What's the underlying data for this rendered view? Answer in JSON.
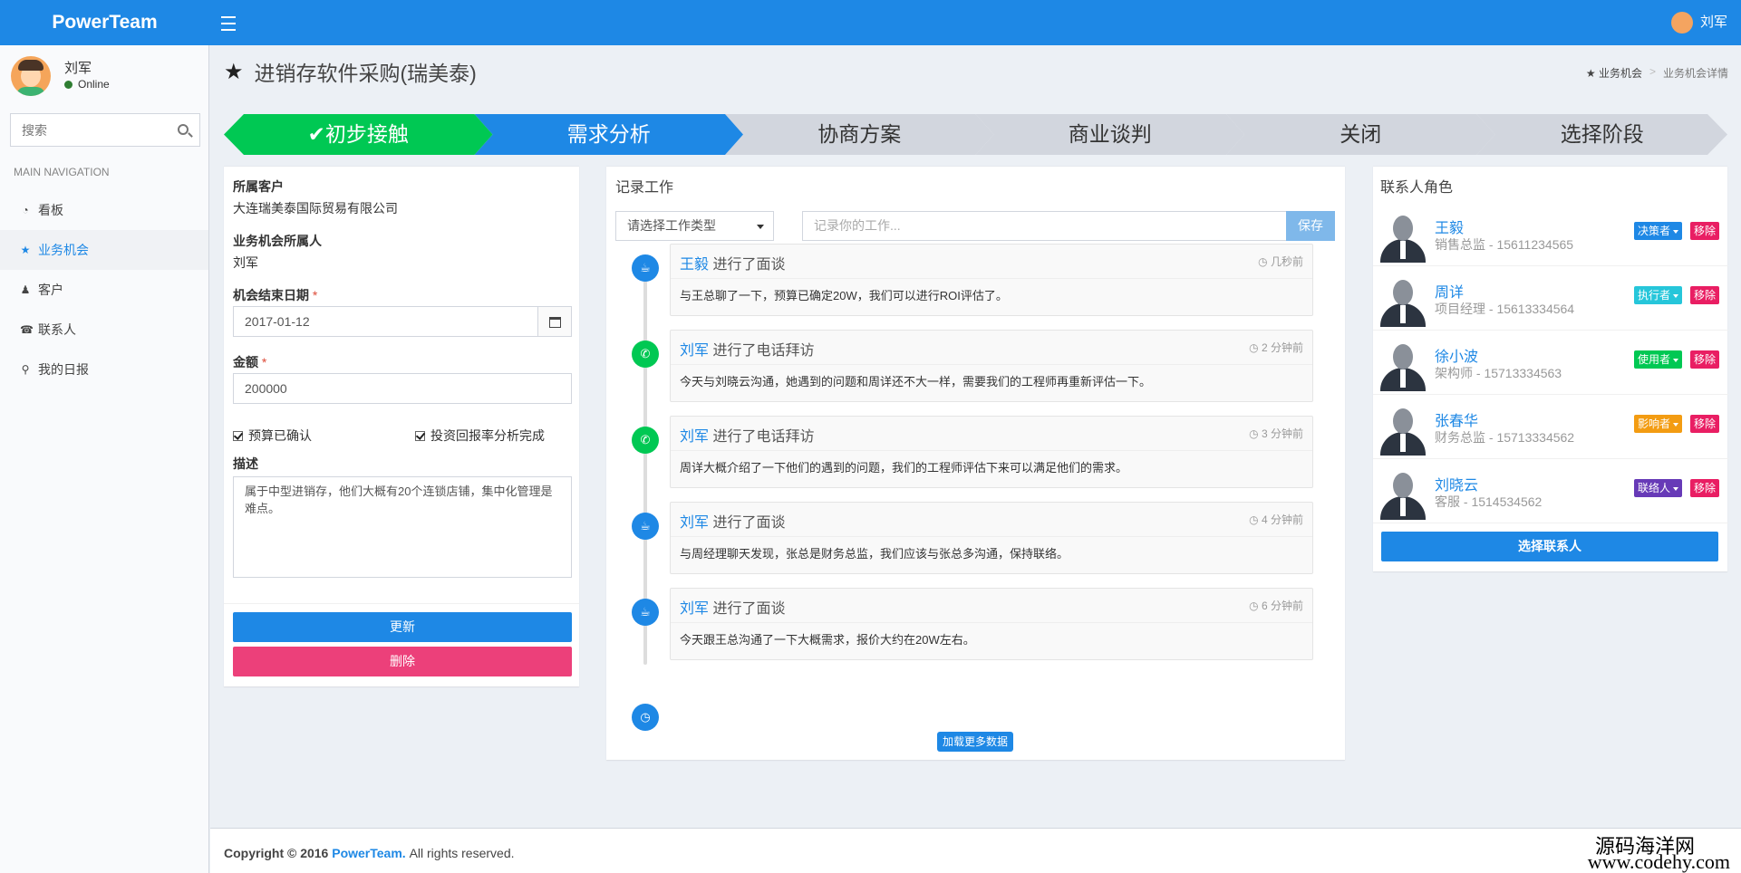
{
  "header": {
    "brand": "PowerTeam",
    "user_name": "刘军"
  },
  "sidebar": {
    "user": {
      "name": "刘军",
      "status": "Online"
    },
    "search_placeholder": "搜索",
    "nav_header": "MAIN NAVIGATION",
    "items": [
      {
        "label": "看板",
        "icon": "dashboard-icon",
        "active": false
      },
      {
        "label": "业务机会",
        "icon": "star-icon",
        "active": true
      },
      {
        "label": "客户",
        "icon": "user-icon",
        "active": false
      },
      {
        "label": "联系人",
        "icon": "phone-icon",
        "active": false
      },
      {
        "label": "我的日报",
        "icon": "pin-icon",
        "active": false
      }
    ]
  },
  "page": {
    "title": "进销存软件采购(瑞美泰)",
    "breadcrumb": [
      "业务机会",
      "业务机会详情"
    ]
  },
  "stages": [
    {
      "label": "✔初步接触",
      "state": "done",
      "color": "#00c853"
    },
    {
      "label": "需求分析",
      "state": "current",
      "color": "#1e88e5"
    },
    {
      "label": "协商方案",
      "state": "todo",
      "color": "#d2d6de"
    },
    {
      "label": "商业谈判",
      "state": "todo",
      "color": "#d2d6de"
    },
    {
      "label": "关闭",
      "state": "todo",
      "color": "#d2d6de"
    },
    {
      "label": "选择阶段",
      "state": "todo",
      "color": "#d2d6de"
    }
  ],
  "opportunity": {
    "customer_label": "所属客户",
    "customer_value": "大连瑞美泰国际贸易有限公司",
    "owner_label": "业务机会所属人",
    "owner_value": "刘军",
    "end_date_label": "机会结束日期",
    "end_date_value": "2017-01-12",
    "amount_label": "金额",
    "amount_value": "200000",
    "required_mark": "*",
    "check_budget": "预算已确认",
    "check_roi": "投资回报率分析完成",
    "desc_label": "描述",
    "desc_value": "属于中型进销存，他们大概有20个连锁店铺，集中化管理是难点。",
    "update_label": "更新",
    "delete_label": "删除"
  },
  "work_log": {
    "title": "记录工作",
    "type_placeholder": "请选择工作类型",
    "work_placeholder": "记录你的工作...",
    "save_label": "保存",
    "load_more": "加载更多数据",
    "entries": [
      {
        "user": "王毅",
        "action": "进行了面谈",
        "time": "几秒前",
        "body": "与王总聊了一下，预算已确定20W，我们可以进行ROI评估了。",
        "icon": "coffee-icon",
        "color": "#1e88e5"
      },
      {
        "user": "刘军",
        "action": "进行了电话拜访",
        "time": "2 分钟前",
        "body": "今天与刘晓云沟通，她遇到的问题和周详还不大一样，需要我们的工程师再重新评估一下。",
        "icon": "phone-icon",
        "color": "#00c853"
      },
      {
        "user": "刘军",
        "action": "进行了电话拜访",
        "time": "3 分钟前",
        "body": "周详大概介绍了一下他们的遇到的问题，我们的工程师评估下来可以满足他们的需求。",
        "icon": "phone-icon",
        "color": "#00c853"
      },
      {
        "user": "刘军",
        "action": "进行了面谈",
        "time": "4 分钟前",
        "body": "与周经理聊天发现，张总是财务总监，我们应该与张总多沟通，保持联络。",
        "icon": "coffee-icon",
        "color": "#1e88e5"
      },
      {
        "user": "刘军",
        "action": "进行了面谈",
        "time": "6 分钟前",
        "body": "今天跟王总沟通了一下大概需求，报价大约在20W左右。",
        "icon": "coffee-icon",
        "color": "#1e88e5"
      }
    ]
  },
  "contacts": {
    "title": "联系人角色",
    "remove_label": "移除",
    "choose_label": "选择联系人",
    "items": [
      {
        "name": "王毅",
        "info": "销售总监 - 15611234565",
        "role": "决策者",
        "role_color": "#1e88e5"
      },
      {
        "name": "周详",
        "info": "项目经理 - 15613334564",
        "role": "执行者",
        "role_color": "#26c6da"
      },
      {
        "name": "徐小波",
        "info": "架构师 - 15713334563",
        "role": "使用者",
        "role_color": "#00c853"
      },
      {
        "name": "张春华",
        "info": "财务总监 - 15713334562",
        "role": "影响者",
        "role_color": "#f39c12"
      },
      {
        "name": "刘晓云",
        "info": "客服 - 1514534562",
        "role": "联络人",
        "role_color": "#673ab7"
      }
    ],
    "remove_color": "#e91e63"
  },
  "footer": {
    "copyright": "Copyright © 2016",
    "brand": "PowerTeam.",
    "rest": "All rights reserved.",
    "watermark_cn": "源码海洋网",
    "watermark_url": "www.codehy.com"
  }
}
